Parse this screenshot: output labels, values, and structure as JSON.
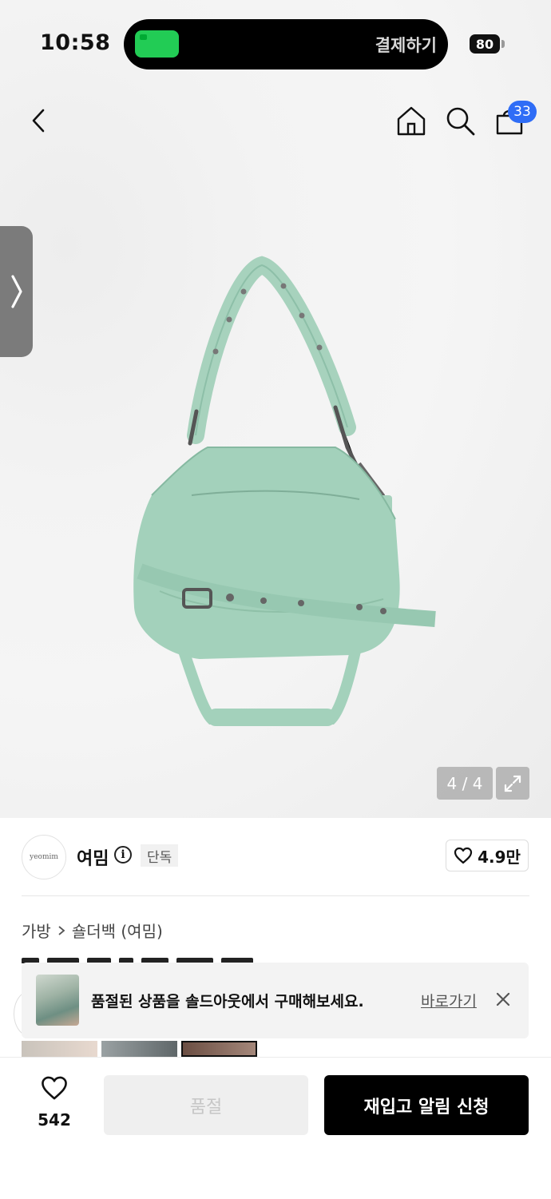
{
  "status_bar": {
    "time": "10:58",
    "live_activity_label": "결제하기",
    "battery": "80"
  },
  "nav": {
    "cart_count": "33",
    "icons": [
      "back-icon",
      "home-icon",
      "search-icon",
      "cart-icon"
    ]
  },
  "gallery": {
    "counter": "4 / 4",
    "product_color": "#9ccdb4"
  },
  "brand": {
    "logo_text": "yeomim",
    "name": "여밈",
    "badge": "단독",
    "likes": "4.9만"
  },
  "breadcrumb": {
    "category": "가방",
    "subcategory": "숄더백 (여밈)"
  },
  "toast": {
    "message": "품절된 상품을 솔드아웃에서 구매해보세요.",
    "link": "바로가기"
  },
  "bottom_bar": {
    "wish_count": "542",
    "soldout_label": "품절",
    "restock_label": "재입고 알림 신청"
  }
}
